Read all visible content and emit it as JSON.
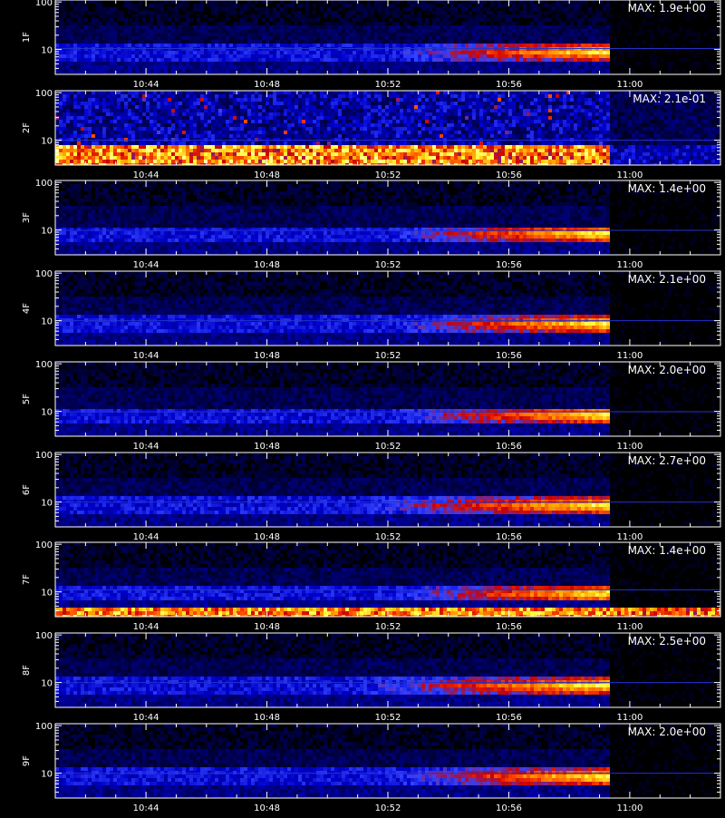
{
  "chart_data": {
    "type": "heatmap",
    "x_tick_labels": [
      "10:44",
      "10:48",
      "10:52",
      "10:56",
      "11:00"
    ],
    "y_tick_labels": [
      "100",
      "10"
    ],
    "time_range": [
      "10:41",
      "11:03"
    ],
    "y_scale": "log",
    "ylim": [
      3,
      110
    ],
    "data_end_time": "10:59:20",
    "colorscale": [
      "#000000",
      "#000066",
      "#0000cc",
      "#3344ff",
      "#cc0000",
      "#ff5000",
      "#ffaa00",
      "#ffff40",
      "#ffffdd"
    ],
    "panels": [
      {
        "label": "1F",
        "max_label": "MAX: 1.9e+00",
        "pattern": "band",
        "onset": "10:52",
        "line_y": 10.5
      },
      {
        "label": "2F",
        "max_label": "MAX: 2.1e-01",
        "pattern": "noise",
        "onset": "10:41",
        "line_y": 10
      },
      {
        "label": "3F",
        "max_label": "MAX: 1.4e+00",
        "pattern": "band",
        "onset": "10:52",
        "line_y": 9.8
      },
      {
        "label": "4F",
        "max_label": "MAX: 2.1e+00",
        "pattern": "band",
        "onset": "10:52",
        "line_y": 10
      },
      {
        "label": "5F",
        "max_label": "MAX: 2.0e+00",
        "pattern": "band",
        "onset": "10:52",
        "line_y": 9.8
      },
      {
        "label": "6F",
        "max_label": "MAX: 2.7e+00",
        "pattern": "band",
        "onset": "10:51",
        "line_y": 10
      },
      {
        "label": "7F",
        "max_label": "MAX: 1.4e+00",
        "pattern": "band_bottom",
        "onset": "10:52",
        "line_y": 11
      },
      {
        "label": "8F",
        "max_label": "MAX: 2.5e+00",
        "pattern": "band",
        "onset": "10:51",
        "line_y": 10
      },
      {
        "label": "9F",
        "max_label": "MAX: 2.0e+00",
        "pattern": "band",
        "onset": "10:52",
        "line_y": 10
      }
    ]
  }
}
